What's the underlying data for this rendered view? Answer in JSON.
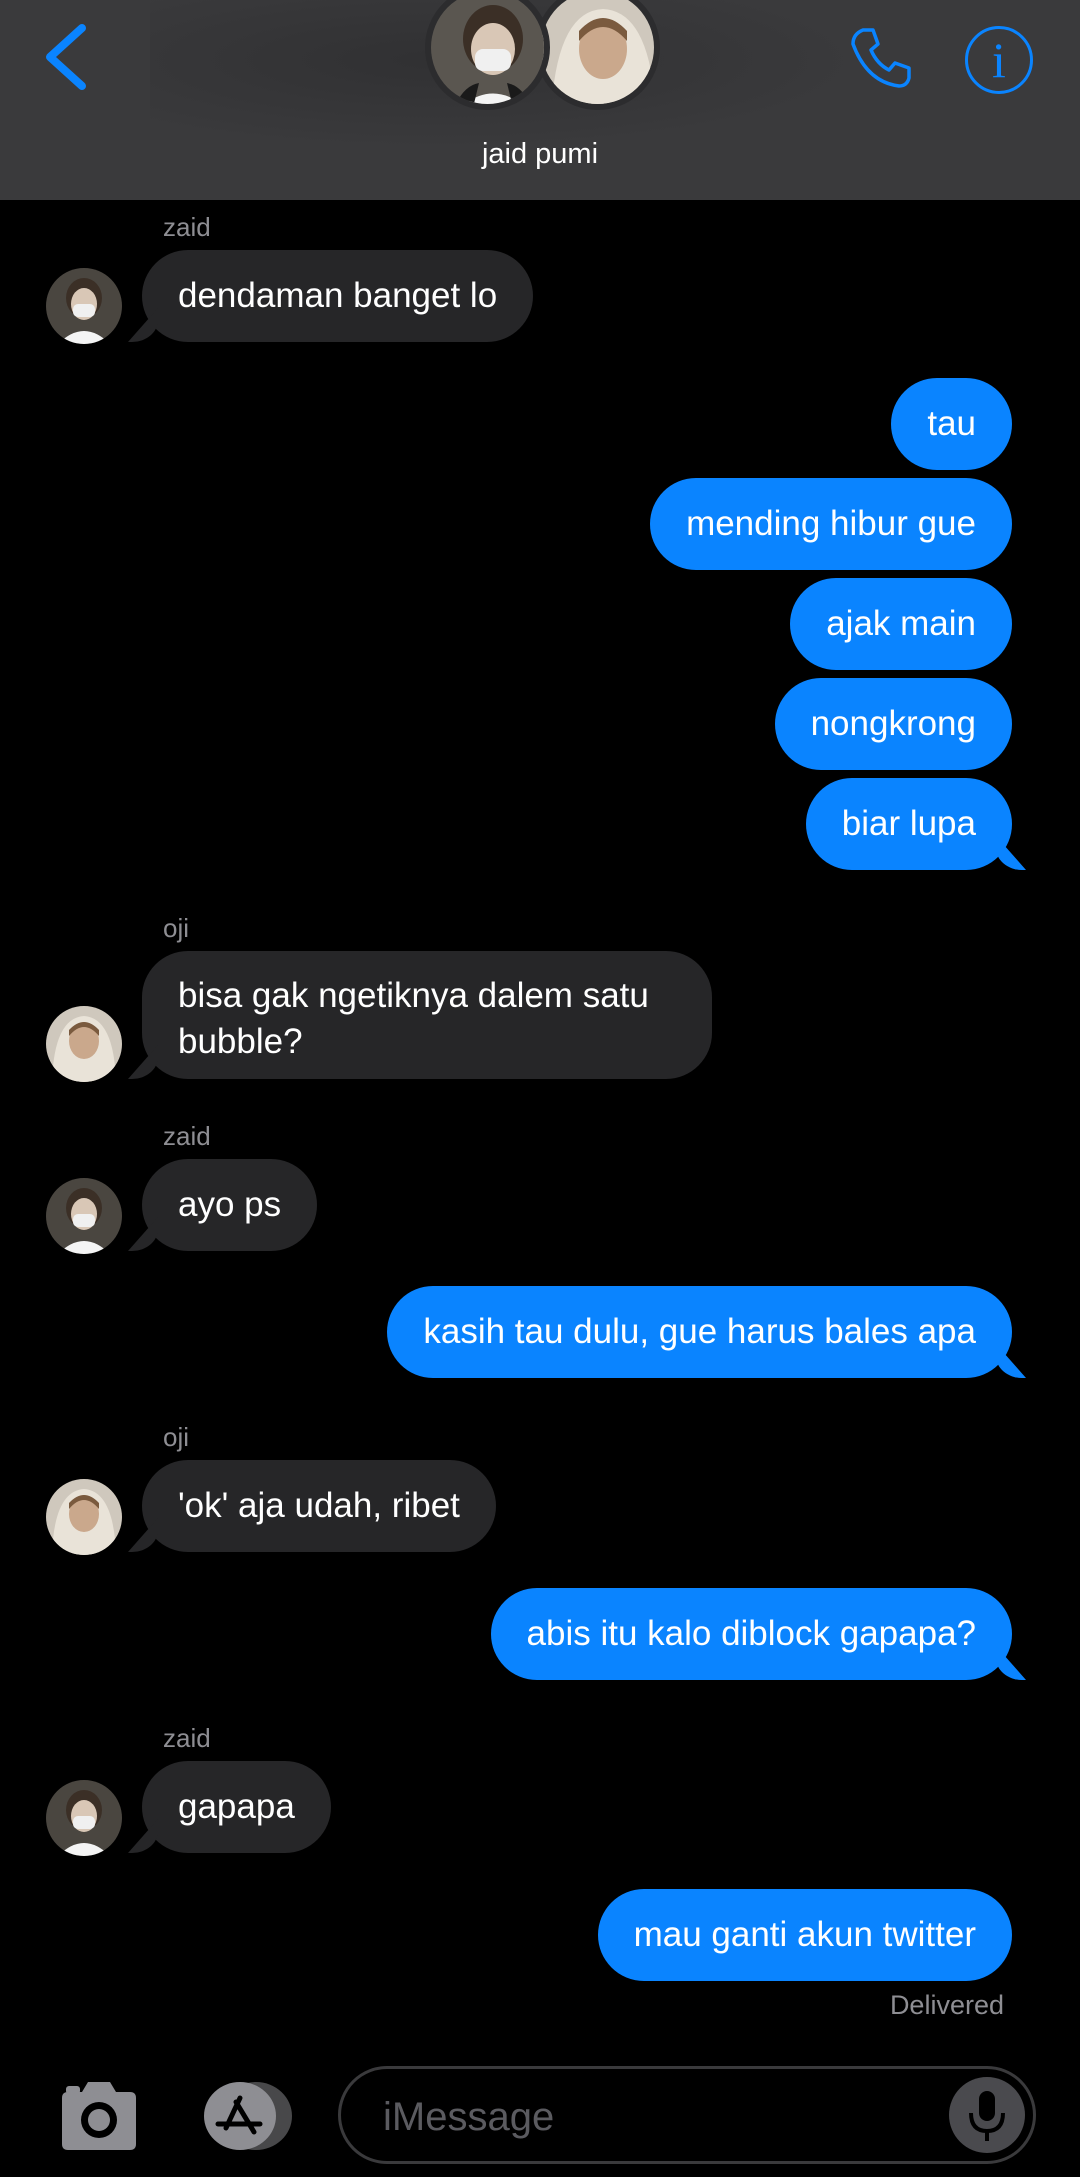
{
  "header": {
    "group_name": "jaid pumi",
    "icons": {
      "back": "chevron-left-icon",
      "call": "phone-icon",
      "info": "info-icon"
    },
    "info_glyph": "i"
  },
  "messages": [
    {
      "type": "in",
      "sender": "zaid",
      "text": "dendaman banget lo"
    },
    {
      "type": "out",
      "text": "tau"
    },
    {
      "type": "out",
      "text": "mending hibur gue"
    },
    {
      "type": "out",
      "text": "ajak main"
    },
    {
      "type": "out",
      "text": "nongkrong"
    },
    {
      "type": "out",
      "text": "biar lupa"
    },
    {
      "type": "in",
      "sender": "oji",
      "text": "bisa gak ngetiknya dalem satu bubble?"
    },
    {
      "type": "in",
      "sender": "zaid",
      "text": "ayo ps"
    },
    {
      "type": "out",
      "text": "kasih tau dulu, gue harus bales apa"
    },
    {
      "type": "in",
      "sender": "oji",
      "text": "'ok' aja udah, ribet"
    },
    {
      "type": "out",
      "text": "abis itu kalo diblock gapapa?"
    },
    {
      "type": "in",
      "sender": "zaid",
      "text": "gapapa"
    },
    {
      "type": "out",
      "text": "mau ganti akun twitter"
    }
  ],
  "status": {
    "delivered": "Delivered"
  },
  "composer": {
    "placeholder": "iMessage",
    "icons": {
      "camera": "camera-icon",
      "apps": "app-store-icon",
      "mic": "microphone-icon"
    }
  },
  "colors": {
    "accent": "#0a84ff",
    "incoming": "#262628",
    "background": "#000000",
    "header": "#3a3a3c"
  }
}
